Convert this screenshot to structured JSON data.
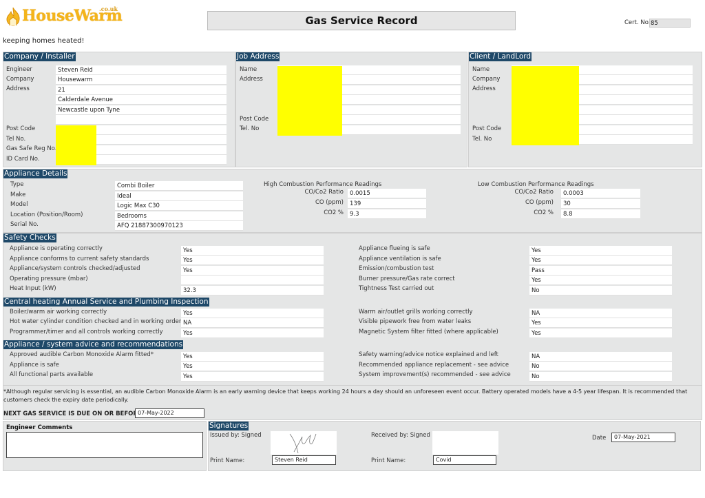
{
  "header": {
    "logo_text": "HouseWarm",
    "logo_suffix": ".co.uk",
    "tagline": "keeping homes heated!",
    "title": "Gas Service Record",
    "cert_label": "Cert. No.",
    "cert_value": "85"
  },
  "company": {
    "heading": "Company / Installer",
    "labels": [
      "Engineer",
      "Company",
      "Address",
      "Post Code",
      "Tel No.",
      "Gas Safe Reg No.",
      "ID Card No."
    ],
    "values": [
      "Steven Reid",
      "Housewarm",
      "21",
      "Calderdale Avenue",
      "Newcastle upon Tyne",
      "",
      "",
      "",
      "",
      ""
    ]
  },
  "job": {
    "heading": "Job Address",
    "labels": [
      "Name",
      "Address",
      "Post Code",
      "Tel. No"
    ]
  },
  "client": {
    "heading": "Client / LandLord",
    "labels": [
      "Name",
      "Company",
      "Address",
      "Post Code",
      "Tel. No"
    ]
  },
  "appliance": {
    "heading": "Appliance Details",
    "labels": [
      "Type",
      "Make",
      "Model",
      "Location (Position/Room)",
      "Serial No."
    ],
    "values": [
      "Combi Boiler",
      "Ideal",
      "Logic Max C30",
      "Bedrooms",
      "AFQ 21887300970123"
    ],
    "high": {
      "title": "High Combustion Performance Readings",
      "labels": [
        "CO/Co2 Ratio",
        "CO (ppm)",
        "CO2 %"
      ],
      "values": [
        "0.0015",
        "139",
        "9.3"
      ]
    },
    "low": {
      "title": "Low Combustion Performance Readings",
      "labels": [
        "CO/Co2 Ratio",
        "CO (ppm)",
        "CO2 %"
      ],
      "values": [
        "0.0003",
        "30",
        "8.8"
      ]
    }
  },
  "safety": {
    "heading": "Safety Checks",
    "left": [
      {
        "label": "Appliance is operating correctly",
        "value": "Yes"
      },
      {
        "label": "Appliance conforms to current safety standards",
        "value": "Yes"
      },
      {
        "label": "Appliance/system controls checked/adjusted",
        "value": "Yes"
      },
      {
        "label": "Operating pressure (mbar)",
        "value": ""
      },
      {
        "label": "Heat Input (kW)",
        "value": "32.3"
      }
    ],
    "right": [
      {
        "label": "Appliance flueing is safe",
        "value": "Yes"
      },
      {
        "label": "Appliance ventilation is safe",
        "value": "Yes"
      },
      {
        "label": "Emission/combustion test",
        "value": "Pass"
      },
      {
        "label": "Burner pressure/Gas rate correct",
        "value": "Yes"
      },
      {
        "label": "Tightness Test carried out",
        "value": "No"
      }
    ]
  },
  "central_heating": {
    "heading": "Central heating Annual Service and Plumbing Inspection",
    "left": [
      {
        "label": "Boiler/warm air working correctly",
        "value": "Yes"
      },
      {
        "label": "Hot water cylinder condition checked and in working order",
        "value": "NA"
      },
      {
        "label": "Programmer/timer and all controls working correctly",
        "value": "Yes"
      }
    ],
    "right": [
      {
        "label": "Warm air/outlet grills working correctly",
        "value": "NA"
      },
      {
        "label": "Visible pipework free from water leaks",
        "value": "Yes"
      },
      {
        "label": "Magnetic System filter fitted (where applicable)",
        "value": "Yes"
      }
    ]
  },
  "advice": {
    "heading": "Appliance / system advice and recommendations",
    "left": [
      {
        "label": "Approved audible Carbon Monoxide Alarm fitted*",
        "value": "Yes"
      },
      {
        "label": "Appliance is safe",
        "value": "Yes"
      },
      {
        "label": "All functional parts available",
        "value": "Yes"
      }
    ],
    "right": [
      {
        "label": "Safety warning/advice notice explained and left",
        "value": "NA"
      },
      {
        "label": "Recommended appliance replacement - see advice",
        "value": "No"
      },
      {
        "label": "System improvement(s) recommended - see advice",
        "value": "No"
      }
    ]
  },
  "footnote": "*Although regular servicing is essential, an audible Carbon Monoxide Alarm is an early warning device that keeps working 24 hours a day should an unforeseen event occur. Battery operated models have a 4-5 year lifespan. It is recommended that customers check the expiry date periodically.",
  "next_service": {
    "label": "NEXT GAS SERVICE IS DUE ON OR BEFORE",
    "value": "07-May-2022"
  },
  "comments": {
    "label": "Engineer Comments",
    "value": ""
  },
  "signatures": {
    "heading": "Signatures",
    "issued_label": "Issued by: Signed",
    "received_label": "Received by: Signed",
    "print_label": "Print Name:",
    "issued_name": "Steven Reid",
    "received_name": "Covid",
    "date_label": "Date",
    "date_value": "07-May-2021"
  }
}
